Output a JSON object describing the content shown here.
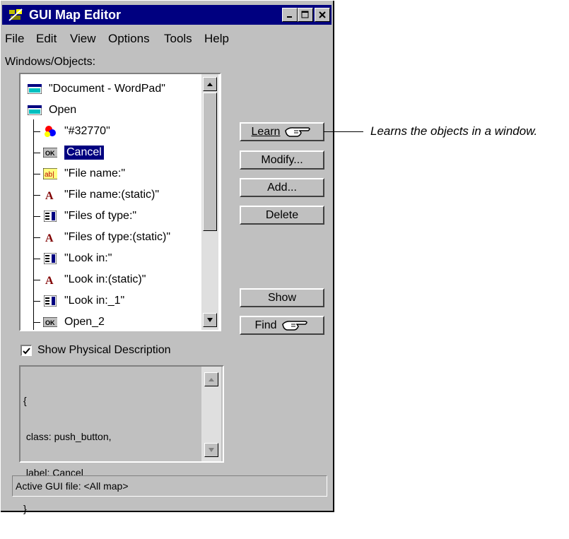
{
  "window": {
    "title": "GUI Map Editor",
    "controls": {
      "minimize": "_",
      "maximize": "□",
      "close": "✕"
    }
  },
  "menu": [
    "File",
    "Edit",
    "View",
    "Options",
    "Tools",
    "Help"
  ],
  "windows_objects_label": "Windows/Objects:",
  "tree": [
    {
      "icon": "window-icon",
      "text": "\"Document - WordPad\"",
      "indent": 0
    },
    {
      "icon": "window-icon",
      "text": "Open",
      "indent": 0
    },
    {
      "icon": "object-icon",
      "text": "\"#32770\"",
      "indent": 1
    },
    {
      "icon": "ok-button-icon",
      "text": "Cancel",
      "indent": 1,
      "selected": true
    },
    {
      "icon": "edit-field-icon",
      "text": "\"File name:\"",
      "indent": 1
    },
    {
      "icon": "static-text-icon",
      "text": "\"File name:(static)\"",
      "indent": 1
    },
    {
      "icon": "list-icon",
      "text": "\"Files of type:\"",
      "indent": 1
    },
    {
      "icon": "static-text-icon",
      "text": "\"Files of type:(static)\"",
      "indent": 1
    },
    {
      "icon": "list-icon",
      "text": "\"Look in:\"",
      "indent": 1
    },
    {
      "icon": "static-text-icon",
      "text": "\"Look in:(static)\"",
      "indent": 1
    },
    {
      "icon": "list-icon",
      "text": "\"Look in:_1\"",
      "indent": 1
    },
    {
      "icon": "ok-button-icon",
      "text": "Open_2",
      "indent": 1
    }
  ],
  "buttons": {
    "learn": "Learn",
    "modify": "Modify...",
    "add": "Add...",
    "delete": "Delete",
    "show": "Show",
    "find": "Find"
  },
  "show_physical_description": {
    "label": "Show Physical Description",
    "checked": true
  },
  "description_lines": [
    "{",
    " class: push_button,",
    " label: Cancel",
    "}"
  ],
  "status": "Active GUI file: <All map>",
  "callout": "Learns the objects in a window."
}
